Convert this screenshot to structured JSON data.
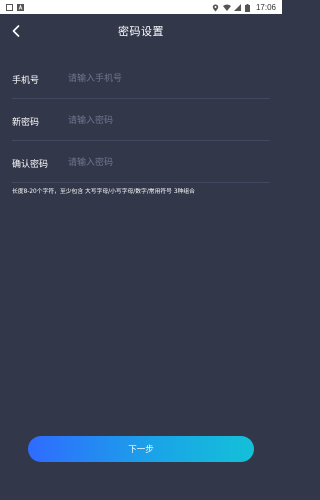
{
  "status_bar": {
    "time": "17:06",
    "icons": [
      "notification-square-icon",
      "a-badge-icon",
      "location-icon",
      "wifi-icon",
      "signal-icon",
      "battery-icon"
    ]
  },
  "nav": {
    "title": "密码设置",
    "back_icon": "chevron-left-icon"
  },
  "form": {
    "phone": {
      "label": "手机号",
      "placeholder": "请输入手机号",
      "value": ""
    },
    "new_password": {
      "label": "新密码",
      "placeholder": "请输入密码",
      "value": ""
    },
    "confirm_password": {
      "label": "确认密码",
      "placeholder": "请输入密码",
      "value": ""
    }
  },
  "hint": "长度8-20个字符，至少包含 大写字母/小写字母/数字/常用符号 3种组合",
  "next_button": {
    "label": "下一步"
  },
  "colors": {
    "background": "#33374a",
    "divider": "#434860",
    "placeholder": "#707690",
    "button_gradient_start": "#2f6bff",
    "button_gradient_end": "#14c0d8"
  }
}
